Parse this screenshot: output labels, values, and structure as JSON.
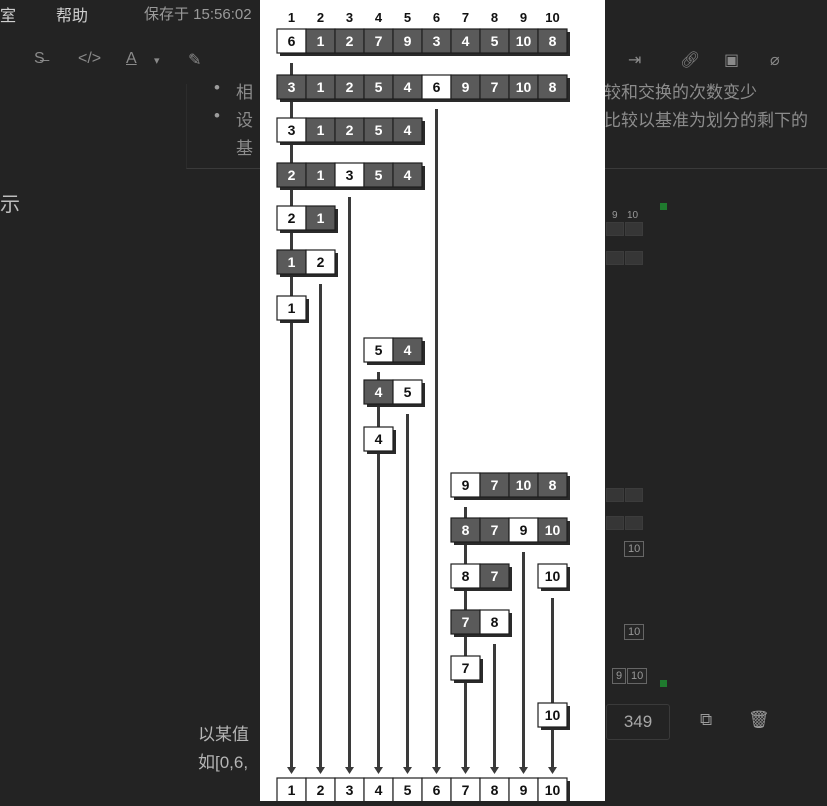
{
  "editor": {
    "menu": [
      "室",
      "帮助"
    ],
    "save_status": "保存于 15:56:02",
    "bullets": [
      {
        "left": "相",
        "right": "较和交换的次数变少"
      },
      {
        "left": "设",
        "right": "比较以基准为划分的剩下的"
      }
    ],
    "line3": "基",
    "side_char": "示",
    "bottom_line1": "以某值",
    "bottom_line2": "如[0,6,",
    "count": "349"
  },
  "colors": {
    "dark_cell": "#5a5a5a",
    "light_cell": "#ffffff",
    "arrow": "#3a3a3a",
    "page_bg": "#232323"
  },
  "diagram": {
    "header": [
      "1",
      "2",
      "3",
      "4",
      "5",
      "6",
      "7",
      "8",
      "9",
      "10"
    ],
    "rows": [
      {
        "col": 0,
        "cells": [
          {
            "v": "6",
            "w": true
          },
          {
            "v": "1"
          },
          {
            "v": "2"
          },
          {
            "v": "7"
          },
          {
            "v": "9"
          },
          {
            "v": "3"
          },
          {
            "v": "4"
          },
          {
            "v": "5"
          },
          {
            "v": "10"
          },
          {
            "v": "8"
          }
        ]
      },
      {
        "col": 0,
        "cells": [
          {
            "v": "3"
          },
          {
            "v": "1"
          },
          {
            "v": "2"
          },
          {
            "v": "5"
          },
          {
            "v": "4"
          },
          {
            "v": "6",
            "w": true
          },
          {
            "v": "9"
          },
          {
            "v": "7"
          },
          {
            "v": "10"
          },
          {
            "v": "8"
          }
        ]
      },
      {
        "col": 0,
        "cells": [
          {
            "v": "3",
            "w": true
          },
          {
            "v": "1"
          },
          {
            "v": "2"
          },
          {
            "v": "5"
          },
          {
            "v": "4"
          }
        ]
      },
      {
        "col": 0,
        "cells": [
          {
            "v": "2"
          },
          {
            "v": "1"
          },
          {
            "v": "3",
            "w": true
          },
          {
            "v": "5"
          },
          {
            "v": "4"
          }
        ]
      },
      {
        "col": 0,
        "cells": [
          {
            "v": "2",
            "w": true
          },
          {
            "v": "1"
          }
        ]
      },
      {
        "col": 0,
        "cells": [
          {
            "v": "1"
          },
          {
            "v": "2",
            "w": true
          }
        ]
      },
      {
        "col": 0,
        "cells": [
          {
            "v": "1",
            "w": true
          }
        ]
      },
      {
        "col": 3,
        "cells": [
          {
            "v": "5",
            "w": true
          },
          {
            "v": "4"
          }
        ]
      },
      {
        "col": 3,
        "cells": [
          {
            "v": "4"
          },
          {
            "v": "5",
            "w": true
          }
        ]
      },
      {
        "col": 3,
        "cells": [
          {
            "v": "4",
            "w": true
          }
        ]
      },
      {
        "col": 6,
        "cells": [
          {
            "v": "9",
            "w": true
          },
          {
            "v": "7"
          },
          {
            "v": "10"
          },
          {
            "v": "8"
          }
        ]
      },
      {
        "col": 6,
        "cells": [
          {
            "v": "8"
          },
          {
            "v": "7"
          },
          {
            "v": "9",
            "w": true
          },
          {
            "v": "10"
          }
        ]
      },
      {
        "col": 6,
        "cells": [
          {
            "v": "8",
            "w": true
          },
          {
            "v": "7"
          }
        ]
      },
      {
        "col": 9,
        "cells": [
          {
            "v": "10",
            "w": true
          }
        ]
      },
      {
        "col": 6,
        "cells": [
          {
            "v": "7"
          },
          {
            "v": "8",
            "w": true
          }
        ]
      },
      {
        "col": 6,
        "cells": [
          {
            "v": "7",
            "w": true
          }
        ]
      },
      {
        "col": 9,
        "cells": [
          {
            "v": "10",
            "w": true
          }
        ]
      }
    ],
    "result": [
      "1",
      "2",
      "3",
      "4",
      "5",
      "6",
      "7",
      "8",
      "9",
      "10"
    ]
  }
}
